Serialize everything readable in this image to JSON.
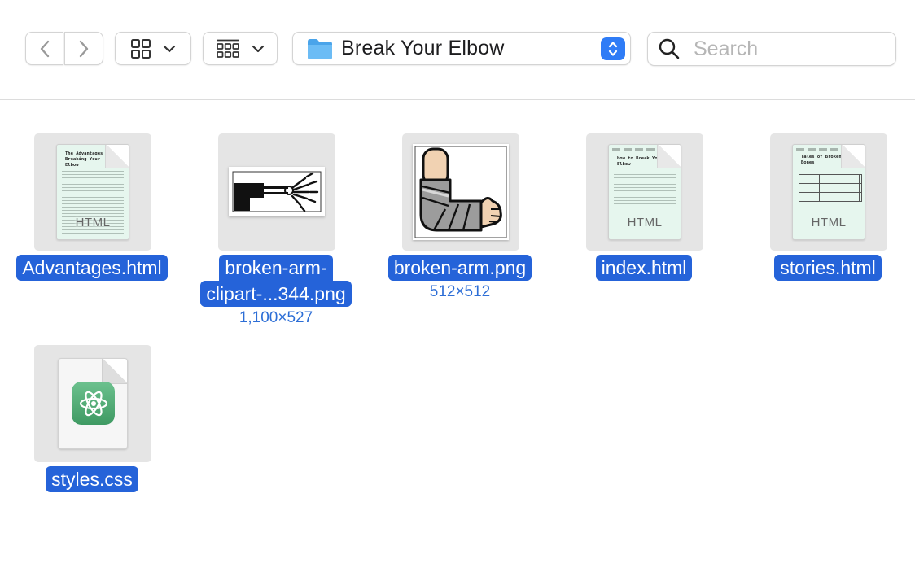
{
  "toolbar": {
    "back_icon": "chevron-left-icon",
    "forward_icon": "chevron-right-icon",
    "view_mode_icon": "icon-grid-icon",
    "group_icon": "group-by-icon",
    "path": {
      "folder_icon": "folder-icon",
      "label": "Break Your Elbow"
    },
    "search": {
      "placeholder": "Search",
      "value": ""
    }
  },
  "colors": {
    "selection": "#2563d9",
    "dimension_text": "#2d6ed6",
    "accent": "#2f7cf6",
    "thumb_bg": "#e5e5e5"
  },
  "files": [
    {
      "name": "Advantages.html",
      "kind": "html",
      "doc_title": "The Advantages of Breaking Your Elbow",
      "type_label": "HTML"
    },
    {
      "name_line1": "broken-arm-",
      "name_line2": "clipart-...344.png",
      "kind": "png",
      "dims": "1,100×527"
    },
    {
      "name": "broken-arm.png",
      "kind": "png",
      "dims": "512×512"
    },
    {
      "name": "index.html",
      "kind": "html",
      "doc_title": "How to Break Your Elbow",
      "type_label": "HTML"
    },
    {
      "name": "stories.html",
      "kind": "html",
      "doc_title": "Tales of Broken Bones",
      "type_label": "HTML"
    },
    {
      "name": "styles.css",
      "kind": "css",
      "app_icon": "atom-icon"
    }
  ]
}
